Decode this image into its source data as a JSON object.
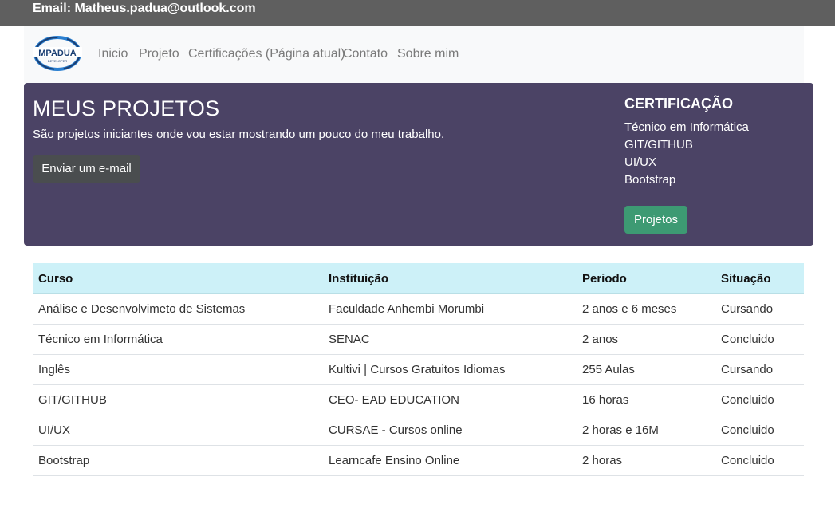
{
  "topbar": {
    "email": "Email: Matheus.padua@outlook.com"
  },
  "brand": {
    "logo_text": "MPADUA",
    "logo_subtext": "DEVELOPER"
  },
  "nav": {
    "items": [
      {
        "label": "Inicio"
      },
      {
        "label": "Projeto"
      },
      {
        "label": "Certificações (Página atual)"
      },
      {
        "label": "Contato"
      },
      {
        "label": "Sobre mim"
      }
    ]
  },
  "hero": {
    "title": "MEUS PROJETOS",
    "subtitle": "São projetos iniciantes onde vou estar mostrando um pouco do meu trabalho.",
    "email_button": "Enviar um e-mail",
    "cert_title": "CERTIFICAÇÃO",
    "cert_items": [
      "Técnico em Informática",
      "GIT/GITHUB",
      "UI/UX",
      "Bootstrap"
    ],
    "projects_button": "Projetos"
  },
  "table": {
    "headers": [
      "Curso",
      "Instituição",
      "Periodo",
      "Situação"
    ],
    "rows": [
      [
        "Análise e Desenvolvimeto de Sistemas",
        "Faculdade Anhembi Morumbi",
        "2 anos e 6 meses",
        "Cursando"
      ],
      [
        "Técnico em Informática",
        "SENAC",
        "2 anos",
        "Concluido"
      ],
      [
        "Inglês",
        "Kultivi | Cursos Gratuitos Idiomas",
        "255 Aulas",
        "Cursando"
      ],
      [
        "GIT/GITHUB",
        "CEO- EAD EDUCATION",
        "16 horas",
        "Concluido"
      ],
      [
        "UI/UX",
        "CURSAE - Cursos online",
        "2 horas e 16M",
        "Concluido"
      ],
      [
        "Bootstrap",
        "Learncafe Ensino Online",
        "2 horas",
        "Concluido"
      ]
    ]
  },
  "colors": {
    "topbar": "#5f5f5f",
    "hero_bg": "#4b4365",
    "email_button": "#4a4d4f",
    "projects_button": "#3d9a73",
    "table_header": "#cdf1f8",
    "logo_blue": "#2a7fd0"
  }
}
